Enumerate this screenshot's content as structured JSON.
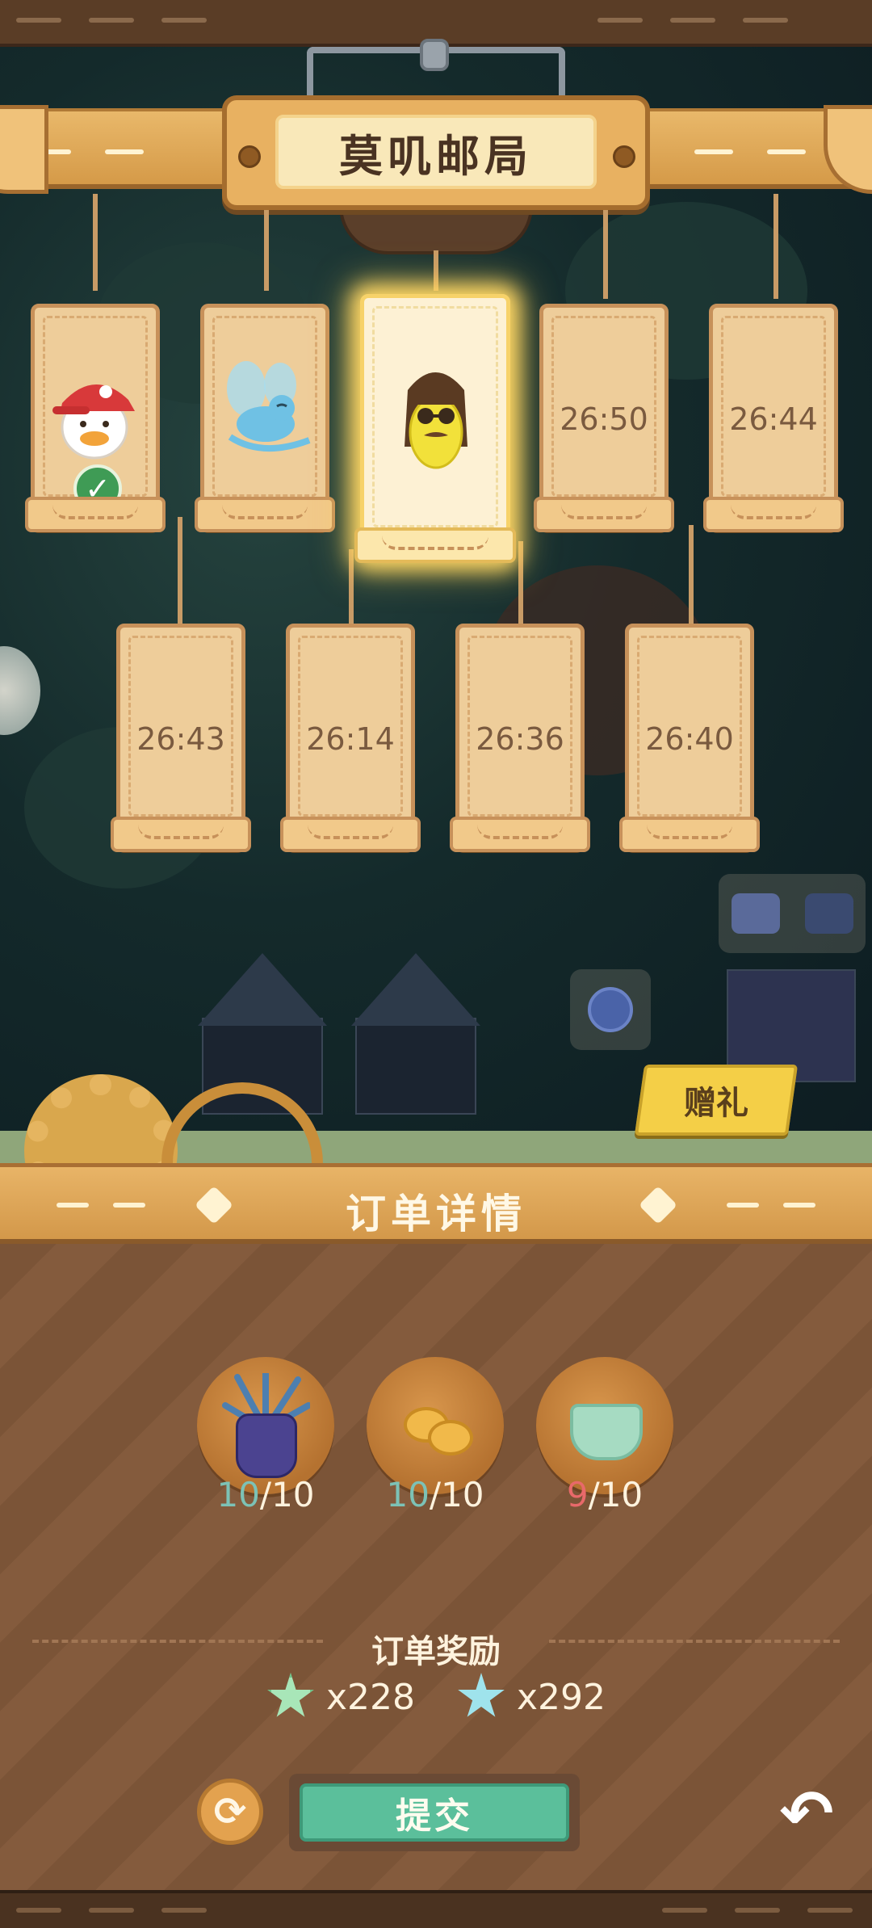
{
  "header": {
    "title": "莫叽邮局"
  },
  "cards_row1": [
    {
      "state": "done",
      "character": "red-cap-duck"
    },
    {
      "state": "ready",
      "character": "blue-fairy-bird"
    },
    {
      "state": "selected",
      "character": "yellow-bean-with-sunglasses"
    },
    {
      "state": "waiting",
      "timer": "26:50"
    },
    {
      "state": "waiting",
      "timer": "26:44"
    }
  ],
  "cards_row2": [
    {
      "state": "waiting",
      "timer": "26:43"
    },
    {
      "state": "waiting",
      "timer": "26:14"
    },
    {
      "state": "waiting",
      "timer": "26:36"
    },
    {
      "state": "waiting",
      "timer": "26:40"
    }
  ],
  "gift": {
    "label": "赠礼"
  },
  "order": {
    "title": "订单详情",
    "items": [
      {
        "icon": "purple-vase-plant-icon",
        "have": "10",
        "need": "/10",
        "status": "ok"
      },
      {
        "icon": "golden-coins-icon",
        "have": "10",
        "need": "/10",
        "status": "ok"
      },
      {
        "icon": "green-jelly-cup-icon",
        "have": "9",
        "need": "/10",
        "status": "short"
      }
    ],
    "reward_label": "订单奖励",
    "rewards": [
      {
        "icon": "green-star-icon",
        "amount": "x228",
        "color": "#a8e6b8"
      },
      {
        "icon": "blue-star-icon",
        "amount": "x292",
        "color": "#9fe3ec"
      }
    ]
  },
  "actions": {
    "submit_label": "提交",
    "refresh_icon": "refresh-icon",
    "back_icon": "back-arrow-icon"
  },
  "colors": {
    "accent": "#e8b161",
    "submit": "#5bbf9b",
    "ok": "#7cc2b6",
    "short": "#e8696a"
  }
}
